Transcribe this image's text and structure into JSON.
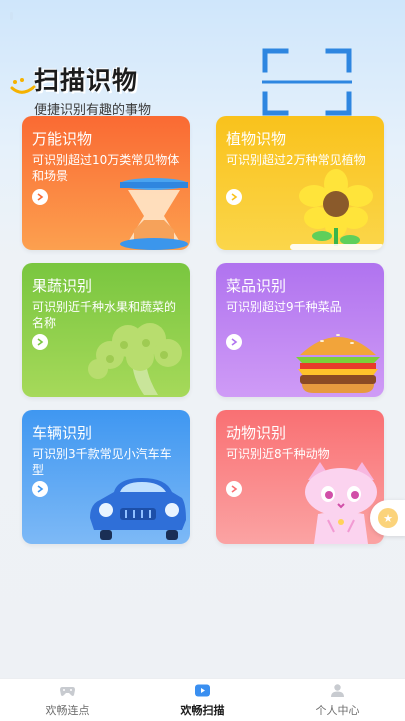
{
  "header": {
    "title": "扫描识物",
    "subtitle": "便捷识别有趣的事物"
  },
  "cards": [
    {
      "title": "万能识物",
      "desc": "可识别超过10万类常见物体和场景",
      "art": "hourglass-illustration"
    },
    {
      "title": "植物识物",
      "desc": "可识别超过2万种常见植物",
      "art": "sunflower-illustration"
    },
    {
      "title": "果蔬识别",
      "desc": "可识别近千种水果和蔬菜的名称",
      "art": "broccoli-illustration"
    },
    {
      "title": "菜品识别",
      "desc": "可识别超过9千种菜品",
      "art": "burger-illustration"
    },
    {
      "title": "车辆识别",
      "desc": "可识别3千款常见小汽车车型",
      "art": "car-illustration"
    },
    {
      "title": "动物识别",
      "desc": "可识别近8千种动物",
      "art": "cat-illustration"
    }
  ],
  "tabbar": {
    "tabs": [
      {
        "label": "欢畅连点",
        "icon": "controller-icon",
        "active": false
      },
      {
        "label": "欢畅扫描",
        "icon": "play-icon",
        "active": true
      },
      {
        "label": "个人中心",
        "icon": "person-icon",
        "active": false
      }
    ]
  },
  "colors": {
    "accent": "#3a8ff0",
    "card_orange": "#fa6a33",
    "card_yellow": "#f9c21c",
    "card_green": "#79c63f",
    "card_purple": "#b073ef",
    "card_blue": "#3f97f1",
    "card_pink": "#f97073"
  }
}
